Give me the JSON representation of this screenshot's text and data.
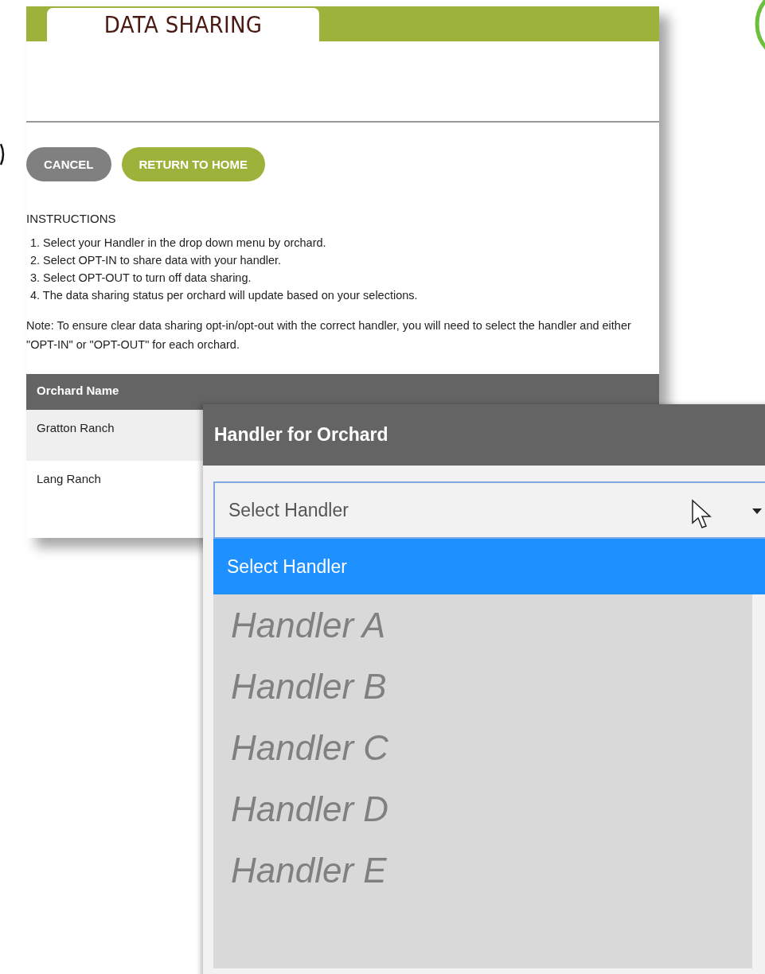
{
  "back_window": {
    "tab_title": "DATA SHARING",
    "buttons": [
      {
        "label": "CANCEL",
        "kind": "secondary"
      },
      {
        "label": "RETURN TO HOME",
        "kind": "primary"
      }
    ],
    "instructions_heading": "INSTRUCTIONS",
    "instructions": [
      "1. Select your Handler in the drop down menu by orchard.",
      "2. Select OPT-IN to share data with your handler.",
      "3. Select OPT-OUT to turn off data sharing.",
      "4. The data sharing status per orchard will update based on your selections."
    ],
    "note": "Note: To ensure clear data sharing opt-in/opt-out with the correct handler, you will need to select the handler and either \"OPT-IN\" or \"OPT-OUT\" for each orchard.",
    "table": {
      "columns": [
        "Orchard Name"
      ],
      "rows": [
        [
          "Gratton Ranch"
        ],
        [
          "Lang Ranch"
        ]
      ]
    }
  },
  "zoom_panel": {
    "heading": "Handler for Orchard",
    "select": {
      "value": "Select Handler"
    },
    "options": [
      {
        "label": "Select Handler",
        "selected": true
      },
      {
        "label": "Handler A",
        "selected": false
      },
      {
        "label": "Handler B",
        "selected": false
      },
      {
        "label": "Handler C",
        "selected": false
      },
      {
        "label": "Handler D",
        "selected": false
      },
      {
        "label": "Handler E",
        "selected": false
      }
    ]
  }
}
